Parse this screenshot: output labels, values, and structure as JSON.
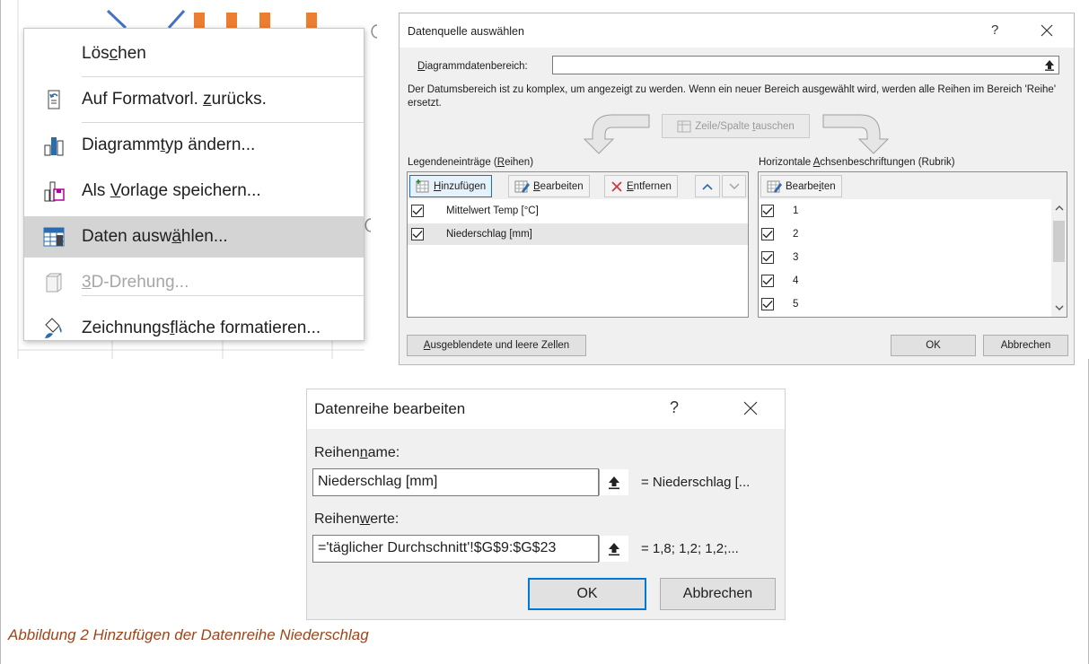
{
  "context_menu": {
    "items": [
      {
        "label_pre": "Lös",
        "label_u": "c",
        "label_post": "hen",
        "icon": "none",
        "state": "normal"
      },
      {
        "label_pre": "Auf Formatvorl. ",
        "label_u": "z",
        "label_post": "urücks.",
        "icon": "reset-format-icon",
        "state": "normal"
      },
      {
        "label_pre": "Diagramm",
        "label_u": "t",
        "label_post": "yp ändern...",
        "icon": "chart-type-icon",
        "state": "normal"
      },
      {
        "label_pre": "Als ",
        "label_u": "V",
        "label_post": "orlage speichern...",
        "icon": "save-template-icon",
        "state": "normal"
      },
      {
        "label_pre": "Daten ausw",
        "label_u": "ä",
        "label_post": "hlen...",
        "icon": "select-data-icon",
        "state": "selected"
      },
      {
        "label_pre": "",
        "label_u": "3",
        "label_post": "D-Drehung...",
        "icon": "3d-rotation-icon",
        "state": "disabled"
      },
      {
        "label_pre": "Zeichnungs",
        "label_u": "f",
        "label_post": "läche formatieren...",
        "icon": "format-plot-area-icon",
        "state": "normal"
      }
    ]
  },
  "source_dialog": {
    "title": "Datenquelle auswählen",
    "help": "?",
    "range_label_u": "D",
    "range_label_rest": "iagrammdatenbereich:",
    "range_value": "",
    "info_text": "Der Datumsbereich ist zu komplex, um angezeigt zu werden. Wenn ein neuer Bereich ausgewählt wird, werden alle Reihen im Bereich 'Reihe' ersetzt.",
    "switch_label_pre": "Zeile/Spalte ",
    "switch_label_u": "t",
    "switch_label_post": "auschen",
    "legend_title_pre": "Legendeneinträge (",
    "legend_title_u": "R",
    "legend_title_post": "eihen)",
    "add_u": "H",
    "add_rest": "inzufügen",
    "edit_u": "B",
    "edit_rest": "earbeiten",
    "remove_u": "E",
    "remove_rest": "ntfernen",
    "series": [
      {
        "name": "Mittelwert Temp [°C]",
        "checked": true,
        "selected": false
      },
      {
        "name": "Niederschlag [mm]",
        "checked": true,
        "selected": true
      }
    ],
    "axis_title_pre": "Horizontale ",
    "axis_title_u": "A",
    "axis_title_post": "chsenbeschriftungen (Rubrik)",
    "axis_edit_pre": "Bearbe",
    "axis_edit_u": "i",
    "axis_edit_post": "ten",
    "categories": [
      "1",
      "2",
      "3",
      "4",
      "5"
    ],
    "hidden_cells_u": "A",
    "hidden_cells_rest": "usgeblendete und leere Zellen",
    "ok": "OK",
    "cancel": "Abbrechen"
  },
  "series_dialog": {
    "title": "Datenreihe bearbeiten",
    "help": "?",
    "name_label_pre": "Reihen",
    "name_label_u": "n",
    "name_label_post": "ame:",
    "name_value": "Niederschlag [mm]",
    "name_ref": "= Niederschlag [...",
    "values_label_pre": "Reihen",
    "values_label_u": "w",
    "values_label_post": "erte:",
    "values_value": "='täglicher Durchschnitt'!$G$9:$G$23",
    "values_ref": "= 1,8; 1,2; 1,2;...",
    "ok": "OK",
    "cancel": "Abbrechen"
  },
  "caption": "Abbildung 2   Hinzufügen der Datenreihe Niederschlag",
  "colors": {
    "accent": "#0078d7",
    "caption": "#a0441a",
    "bar_orange": "#ed7d31",
    "line_blue": "#4472c4",
    "selected_menu": "#d4d4d4"
  }
}
